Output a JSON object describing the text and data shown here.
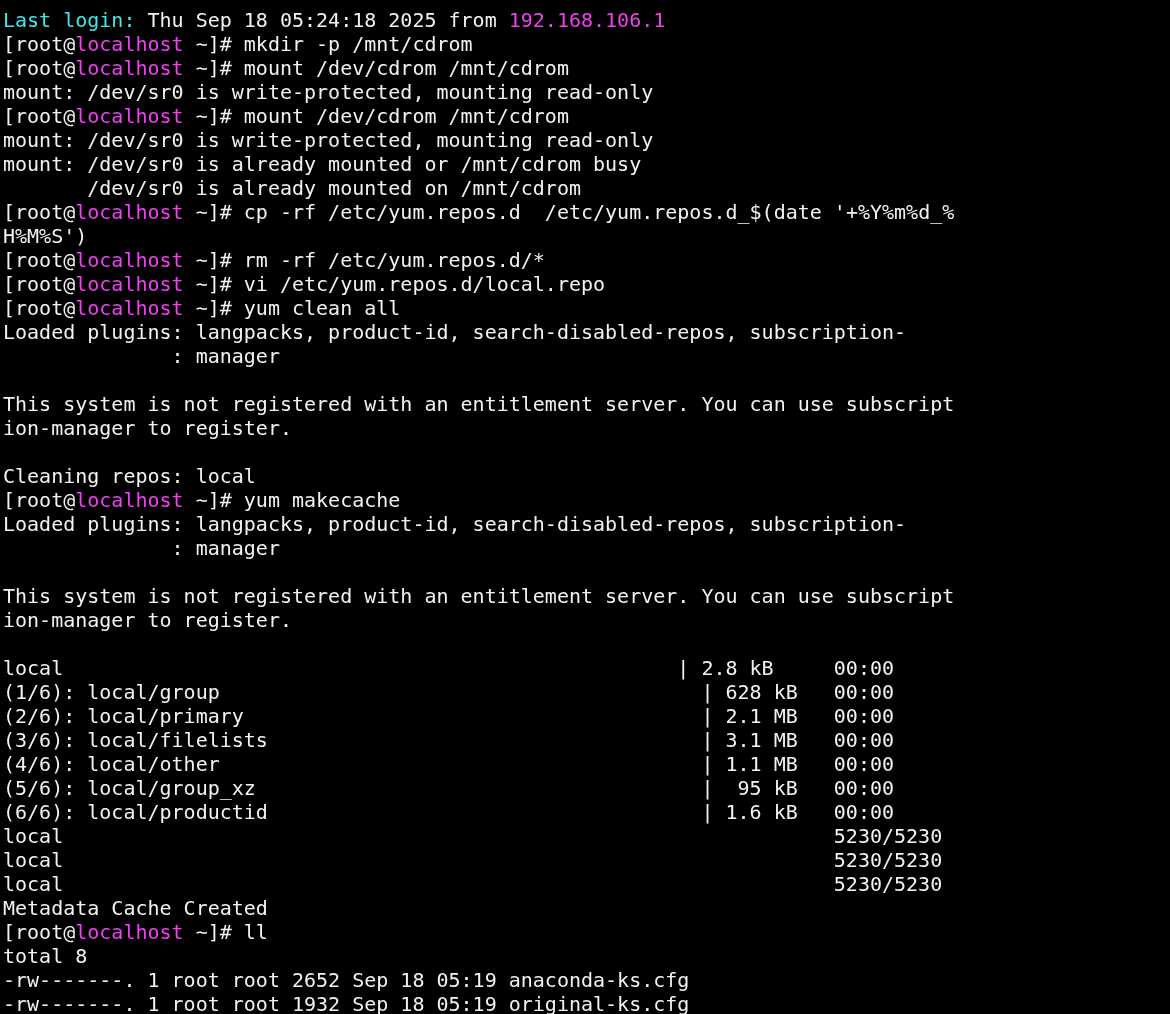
{
  "terminal": {
    "blocks": [
      {
        "lines": [
          {
            "segments": [
              {
                "kind": "label",
                "text": "Last login:"
              },
              {
                "kind": "text",
                "text": " Thu Sep 18 05:24:18 2025 from "
              },
              {
                "kind": "address",
                "text": "192.168.106.1"
              }
            ]
          },
          {
            "segments": [
              {
                "kind": "text",
                "text": "[root@"
              },
              {
                "kind": "host",
                "text": "localhost"
              },
              {
                "kind": "text",
                "text": " ~]# mkdir -p /mnt/cdrom"
              }
            ]
          },
          {
            "segments": [
              {
                "kind": "text",
                "text": "[root@"
              },
              {
                "kind": "host",
                "text": "localhost"
              },
              {
                "kind": "text",
                "text": " ~]# mount /dev/cdrom /mnt/cdrom"
              }
            ]
          },
          {
            "segments": [
              {
                "kind": "text",
                "text": "mount: /dev/sr0 is write-protected, mounting read-only"
              }
            ]
          },
          {
            "segments": [
              {
                "kind": "text",
                "text": "[root@"
              },
              {
                "kind": "host",
                "text": "localhost"
              },
              {
                "kind": "text",
                "text": " ~]# mount /dev/cdrom /mnt/cdrom"
              }
            ]
          },
          {
            "segments": [
              {
                "kind": "text",
                "text": "mount: /dev/sr0 is write-protected, mounting read-only"
              }
            ]
          },
          {
            "segments": [
              {
                "kind": "text",
                "text": "mount: /dev/sr0 is already mounted or /mnt/cdrom busy"
              }
            ]
          },
          {
            "segments": [
              {
                "kind": "text",
                "text": "       /dev/sr0 is already mounted on /mnt/cdrom"
              }
            ]
          },
          {
            "segments": [
              {
                "kind": "text",
                "text": "[root@"
              },
              {
                "kind": "host",
                "text": "localhost"
              },
              {
                "kind": "text",
                "text": " ~]# cp -rf /etc/yum.repos.d  /etc/yum.repos.d_$(date '+%Y%m%d_%"
              }
            ]
          },
          {
            "segments": [
              {
                "kind": "text",
                "text": "H%M%S')"
              }
            ]
          },
          {
            "segments": [
              {
                "kind": "text",
                "text": "[root@"
              },
              {
                "kind": "host",
                "text": "localhost"
              },
              {
                "kind": "text",
                "text": " ~]# rm -rf /etc/yum.repos.d/*"
              }
            ]
          },
          {
            "segments": [
              {
                "kind": "text",
                "text": "[root@"
              },
              {
                "kind": "host",
                "text": "localhost"
              },
              {
                "kind": "text",
                "text": " ~]# vi /etc/yum.repos.d/local.repo"
              }
            ]
          },
          {
            "segments": [
              {
                "kind": "text",
                "text": "[root@"
              },
              {
                "kind": "host",
                "text": "localhost"
              },
              {
                "kind": "text",
                "text": " ~]# yum clean all"
              }
            ]
          },
          {
            "segments": [
              {
                "kind": "text",
                "text": "Loaded plugins: langpacks, product-id, search-disabled-repos, subscription-"
              }
            ]
          },
          {
            "segments": [
              {
                "kind": "text",
                "text": "              : manager"
              }
            ]
          }
        ]
      },
      {
        "lines": [
          {
            "segments": [
              {
                "kind": "text",
                "text": "This system is not registered with an entitlement server. You can use subscript"
              }
            ]
          },
          {
            "segments": [
              {
                "kind": "text",
                "text": "ion-manager to register."
              }
            ]
          }
        ]
      },
      {
        "lines": [
          {
            "segments": [
              {
                "kind": "text",
                "text": "Cleaning repos: local"
              }
            ]
          },
          {
            "segments": [
              {
                "kind": "text",
                "text": "[root@"
              },
              {
                "kind": "host",
                "text": "localhost"
              },
              {
                "kind": "text",
                "text": " ~]# yum makecache"
              }
            ]
          },
          {
            "segments": [
              {
                "kind": "text",
                "text": "Loaded plugins: langpacks, product-id, search-disabled-repos, subscription-"
              }
            ]
          },
          {
            "segments": [
              {
                "kind": "text",
                "text": "              : manager"
              }
            ]
          }
        ]
      },
      {
        "lines": [
          {
            "segments": [
              {
                "kind": "text",
                "text": "This system is not registered with an entitlement server. You can use subscript"
              }
            ]
          },
          {
            "segments": [
              {
                "kind": "text",
                "text": "ion-manager to register."
              }
            ]
          }
        ]
      },
      {
        "lines": [
          {
            "segments": [
              {
                "kind": "text",
                "text": "local                                                   | 2.8 kB     00:00"
              }
            ]
          },
          {
            "segments": [
              {
                "kind": "text",
                "text": "(1/6): local/group                                        | 628 kB   00:00"
              }
            ]
          },
          {
            "segments": [
              {
                "kind": "text",
                "text": "(2/6): local/primary                                      | 2.1 MB   00:00"
              }
            ]
          },
          {
            "segments": [
              {
                "kind": "text",
                "text": "(3/6): local/filelists                                    | 3.1 MB   00:00"
              }
            ]
          },
          {
            "segments": [
              {
                "kind": "text",
                "text": "(4/6): local/other                                        | 1.1 MB   00:00"
              }
            ]
          },
          {
            "segments": [
              {
                "kind": "text",
                "text": "(5/6): local/group_xz                                     |  95 kB   00:00"
              }
            ]
          },
          {
            "segments": [
              {
                "kind": "text",
                "text": "(6/6): local/productid                                    | 1.6 kB   00:00"
              }
            ]
          },
          {
            "segments": [
              {
                "kind": "text",
                "text": "local                                                                5230/5230"
              }
            ]
          },
          {
            "segments": [
              {
                "kind": "text",
                "text": "local                                                                5230/5230"
              }
            ]
          },
          {
            "segments": [
              {
                "kind": "text",
                "text": "local                                                                5230/5230"
              }
            ]
          },
          {
            "segments": [
              {
                "kind": "text",
                "text": "Metadata Cache Created"
              }
            ]
          },
          {
            "segments": [
              {
                "kind": "text",
                "text": "[root@"
              },
              {
                "kind": "host",
                "text": "localhost"
              },
              {
                "kind": "text",
                "text": " ~]# ll"
              }
            ]
          },
          {
            "segments": [
              {
                "kind": "text",
                "text": "total 8"
              }
            ]
          },
          {
            "segments": [
              {
                "kind": "text",
                "text": "-rw-------. 1 root root 2652 Sep 18 05:19 anaconda-ks.cfg"
              }
            ]
          },
          {
            "segments": [
              {
                "kind": "text",
                "text": "-rw-------. 1 root root 1932 Sep 18 05:19 original-ks.cfg"
              }
            ]
          }
        ]
      }
    ]
  }
}
